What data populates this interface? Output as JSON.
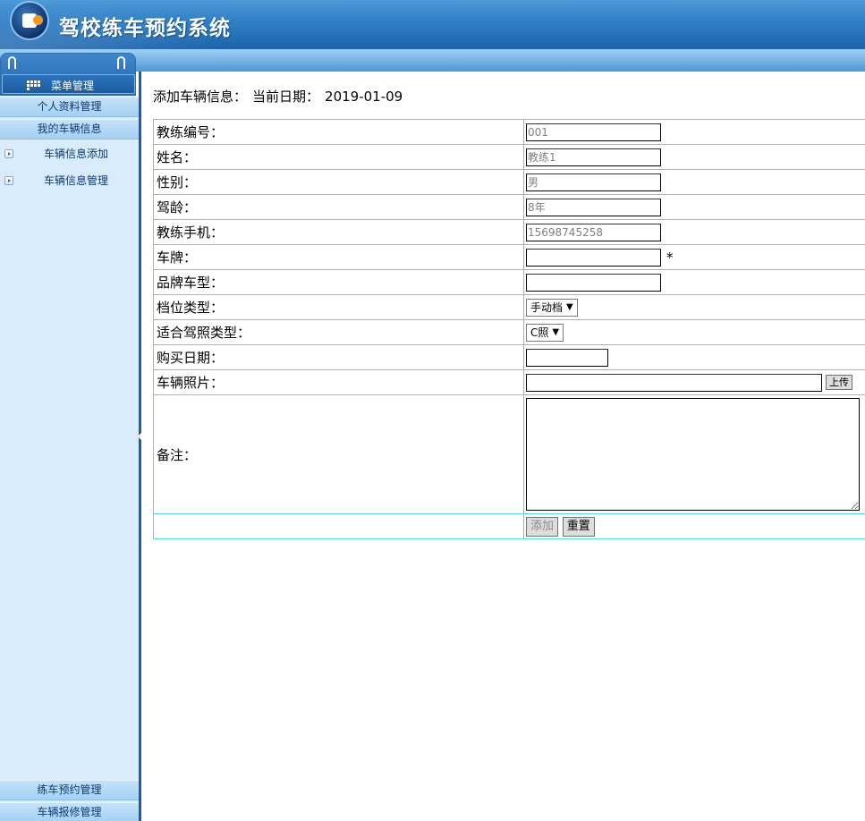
{
  "app": {
    "title": "驾校练车预约系统"
  },
  "menu": {
    "title": "菜单管理"
  },
  "sidebar": {
    "groups": [
      "个人资料管理",
      "我的车辆信息",
      "练车预约管理",
      "车辆报修管理"
    ],
    "sub_items": [
      "车辆信息添加",
      "车辆信息管理"
    ]
  },
  "main": {
    "heading": "添加车辆信息：",
    "date_label": "当前日期：",
    "date_value": "2019-01-09"
  },
  "form": {
    "coach_id": {
      "label": "教练编号：",
      "value": "001"
    },
    "name": {
      "label": "姓名：",
      "value": "教练1"
    },
    "gender": {
      "label": "性别：",
      "value": "男"
    },
    "driving_years": {
      "label": "驾龄：",
      "value": "8年"
    },
    "phone": {
      "label": "教练手机：",
      "value": "15698745258"
    },
    "plate": {
      "label": "车牌：",
      "value": "",
      "required_mark": "*"
    },
    "brand_model": {
      "label": "品牌车型：",
      "value": ""
    },
    "gear_type": {
      "label": "档位类型：",
      "selected": "手动档"
    },
    "license_type": {
      "label": "适合驾照类型：",
      "selected": "C照"
    },
    "purchase_date": {
      "label": "购买日期：",
      "value": ""
    },
    "photo": {
      "label": "车辆照片：",
      "value": "",
      "upload_label": "上传"
    },
    "remark": {
      "label": "备注：",
      "value": ""
    },
    "buttons": {
      "submit": "添加",
      "reset": "重置"
    }
  },
  "colors": {
    "header_blue": "#2f7fc6",
    "table_border": "#4fd7e3",
    "sidebar_bg": "#d9ecfb"
  }
}
